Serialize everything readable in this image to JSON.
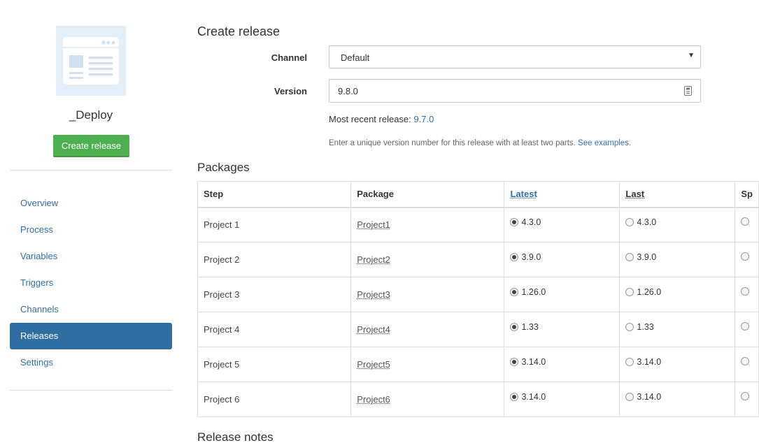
{
  "sidebar": {
    "project_name": "_Deploy",
    "create_button": "Create release",
    "nav": [
      {
        "label": "Overview"
      },
      {
        "label": "Process"
      },
      {
        "label": "Variables"
      },
      {
        "label": "Triggers"
      },
      {
        "label": "Channels"
      },
      {
        "label": "Releases",
        "active": true
      },
      {
        "label": "Settings"
      }
    ]
  },
  "form": {
    "title": "Create release",
    "channel_label": "Channel",
    "channel_value": "Default",
    "version_label": "Version",
    "version_value": "9.8.0",
    "recent_prefix": "Most recent release: ",
    "recent_value": "9.7.0",
    "hint_text": "Enter a unique version number for this release with at least two parts. ",
    "hint_link": "See examples."
  },
  "packages": {
    "title": "Packages",
    "headers": {
      "step": "Step",
      "package": "Package",
      "latest": "Latest",
      "last": "Last",
      "specific": "Sp"
    },
    "rows": [
      {
        "step": "Project 1",
        "package": "Project1",
        "latest": "4.3.0",
        "last": "4.3.0"
      },
      {
        "step": "Project 2",
        "package": "Project2",
        "latest": "3.9.0",
        "last": "3.9.0"
      },
      {
        "step": "Project 3",
        "package": "Project3",
        "latest": "1.26.0",
        "last": "1.26.0"
      },
      {
        "step": "Project 4",
        "package": "Project4",
        "latest": "1.33",
        "last": "1.33"
      },
      {
        "step": "Project 5",
        "package": "Project5",
        "latest": "3.14.0",
        "last": "3.14.0"
      },
      {
        "step": "Project 6",
        "package": "Project6",
        "latest": "3.14.0",
        "last": "3.14.0"
      }
    ]
  },
  "release_notes": {
    "title": "Release notes"
  },
  "colors": {
    "accent": "#2f6fa8",
    "active_nav": "#2f6ea2",
    "primary_button": "#4cb050",
    "logo_bg": "#e3eef8"
  }
}
